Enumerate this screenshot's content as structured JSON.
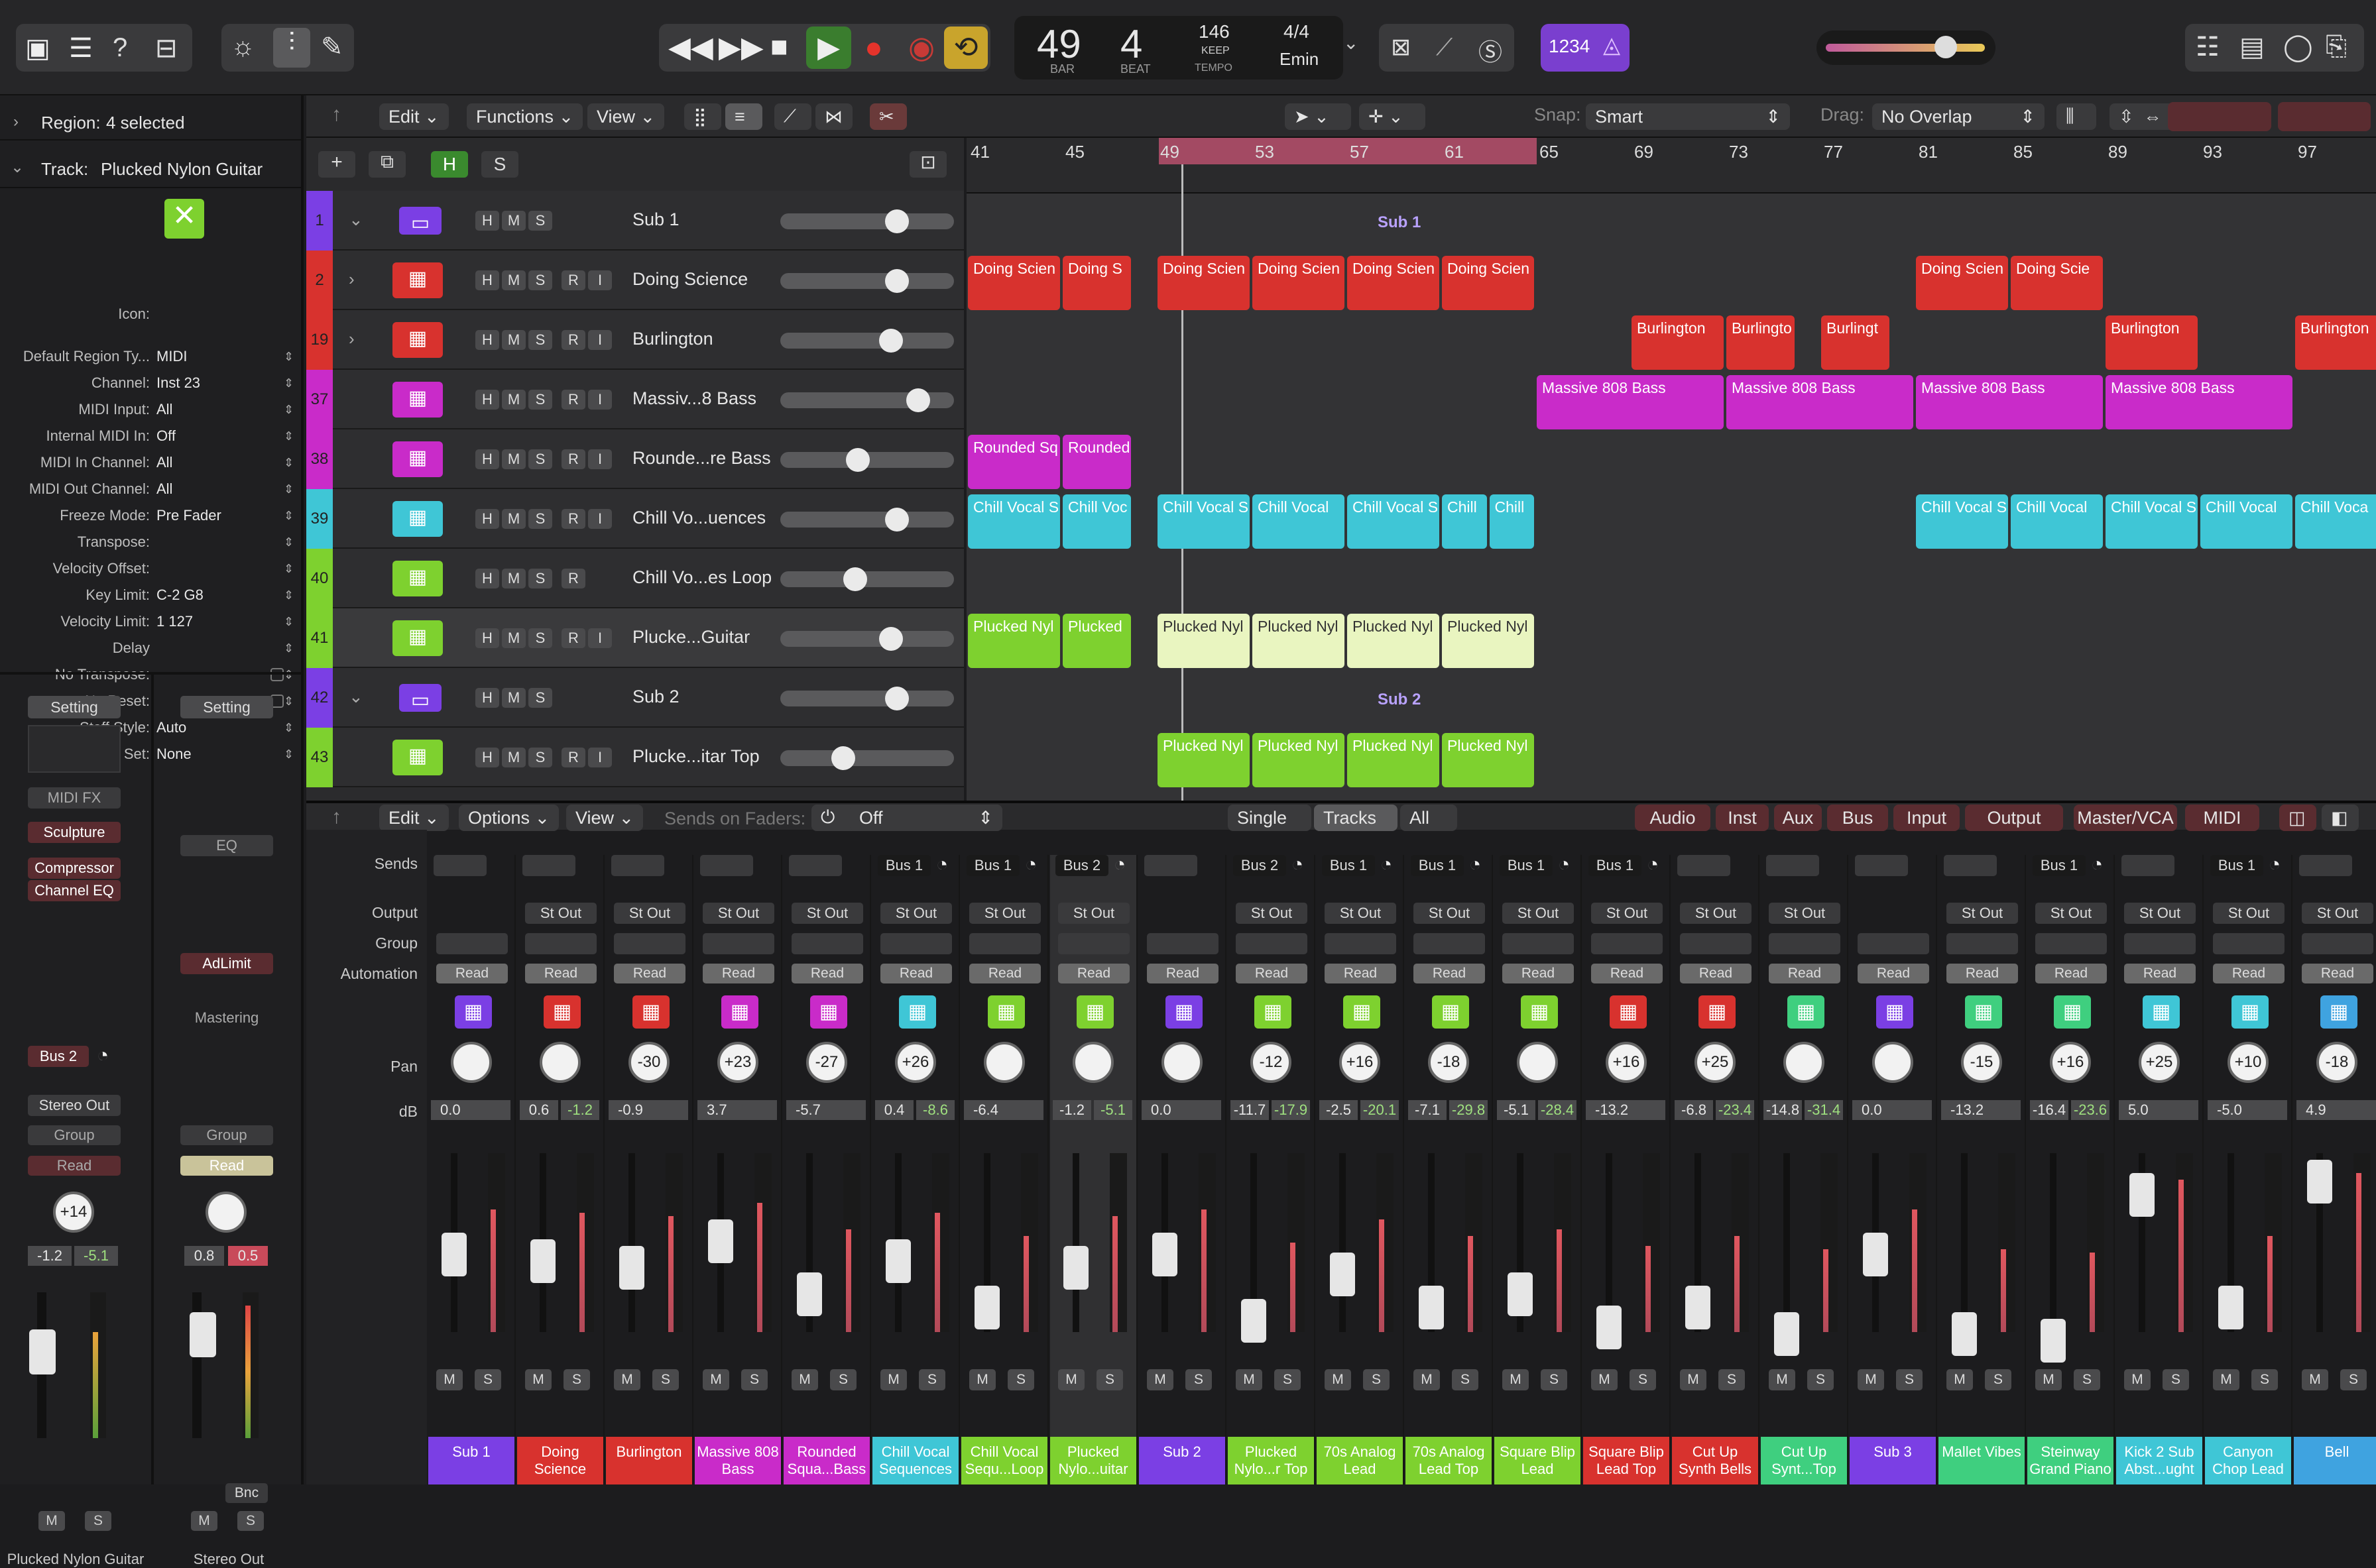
{
  "transport": {
    "bar": "49",
    "beat": "4",
    "bar_label": "BAR",
    "beat_label": "BEAT",
    "tempo": "146",
    "tempo_mode": "KEEP",
    "tempo_label": "TEMPO",
    "signature": "4/4",
    "key": "Emin",
    "cycle_counter": "1234"
  },
  "inspector": {
    "region_label": "Region:",
    "region_value": "4 selected",
    "track_label": "Track:",
    "track_value": "Plucked Nylon Guitar",
    "rows": [
      {
        "label": "Icon:",
        "value": ""
      },
      {
        "label": "Default Region Ty...",
        "value": "MIDI"
      },
      {
        "label": "Channel:",
        "value": "Inst 23"
      },
      {
        "label": "MIDI Input:",
        "value": "All"
      },
      {
        "label": "Internal MIDI In:",
        "value": "Off"
      },
      {
        "label": "MIDI In Channel:",
        "value": "All"
      },
      {
        "label": "MIDI Out Channel:",
        "value": "All"
      },
      {
        "label": "Freeze Mode:",
        "value": "Pre Fader"
      },
      {
        "label": "Transpose:",
        "value": ""
      },
      {
        "label": "Velocity Offset:",
        "value": ""
      },
      {
        "label": "Key Limit:",
        "value": "C-2  G8"
      },
      {
        "label": "Velocity Limit:",
        "value": "1  127"
      },
      {
        "label": "Delay",
        "value": ""
      },
      {
        "label": "No Transpose:",
        "value": ""
      },
      {
        "label": "No Reset:",
        "value": ""
      },
      {
        "label": "Staff Style:",
        "value": "Auto"
      },
      {
        "label": "Articulation Set:",
        "value": "None"
      }
    ]
  },
  "channel_left": {
    "setting": "Setting",
    "midi_fx": "MIDI FX",
    "plugins": [
      "Sculpture",
      "Compressor",
      "Channel EQ"
    ],
    "send": "Bus 2",
    "output": "Stereo Out",
    "group": "Group",
    "automation": "Read",
    "pan": "+14",
    "db1": "-1.2",
    "db2": "-5.1",
    "m": "M",
    "s": "S",
    "name": "Plucked Nylon Guitar"
  },
  "channel_right": {
    "setting": "Setting",
    "eq": "EQ",
    "plugins": [
      "AdLimit"
    ],
    "mastering": "Mastering",
    "group": "Group",
    "automation": "Read",
    "db1": "0.8",
    "db2": "0.5",
    "bnc": "Bnc",
    "m": "M",
    "s": "S",
    "name": "Stereo Out"
  },
  "tracks_menu": {
    "edit": "Edit",
    "functions": "Functions",
    "view": "View",
    "snap_label": "Snap:",
    "snap": "Smart",
    "drag_label": "Drag:",
    "drag": "No Overlap",
    "h": "H",
    "s": "S"
  },
  "ruler": [
    "41",
    "45",
    "49",
    "53",
    "57",
    "61",
    "65",
    "69",
    "73",
    "77",
    "81",
    "85",
    "89",
    "93",
    "97"
  ],
  "tracks": [
    {
      "num": "1",
      "name": "Sub 1",
      "color": "#7b3fe4",
      "flags": [
        "H",
        "M",
        "S"
      ]
    },
    {
      "num": "2",
      "name": "Doing Science",
      "color": "#d8322e",
      "flags": [
        "H",
        "M",
        "S",
        "R",
        "I"
      ]
    },
    {
      "num": "19",
      "name": "Burlington",
      "color": "#d8322e",
      "flags": [
        "H",
        "M",
        "S",
        "R",
        "I"
      ]
    },
    {
      "num": "37",
      "name": "Massiv...8 Bass",
      "color": "#c92bc9",
      "flags": [
        "H",
        "M",
        "S",
        "R",
        "I"
      ]
    },
    {
      "num": "38",
      "name": "Rounde...re Bass",
      "color": "#c92bc9",
      "flags": [
        "H",
        "M",
        "S",
        "R",
        "I"
      ]
    },
    {
      "num": "39",
      "name": "Chill Vo...uences",
      "color": "#3fc6d6",
      "flags": [
        "H",
        "M",
        "S",
        "R",
        "I"
      ]
    },
    {
      "num": "40",
      "name": "Chill Vo...es Loop",
      "color": "#7ed12f",
      "flags": [
        "H",
        "M",
        "S",
        "R"
      ]
    },
    {
      "num": "41",
      "name": "Plucke...Guitar",
      "color": "#7ed12f",
      "flags": [
        "H",
        "M",
        "S",
        "R",
        "I"
      ]
    },
    {
      "num": "42",
      "name": "Sub 2",
      "color": "#7b3fe4",
      "flags": [
        "H",
        "M",
        "S"
      ]
    },
    {
      "num": "43",
      "name": "Plucke...itar Top",
      "color": "#7ed12f",
      "flags": [
        "H",
        "M",
        "S",
        "R",
        "I"
      ]
    }
  ],
  "regions": {
    "sub1": "Sub 1",
    "sub2": "Sub 2",
    "doing": "Doing Scien",
    "doing_s": "Doing S",
    "doing_scie": "Doing Scie",
    "burl": "Burlington",
    "burl_short": "Burlingto",
    "burl_shorter": "Burlingt",
    "massive": "Massive 808 Bass",
    "rounded": "Rounded Sq",
    "rounded2": "Rounded",
    "chill": "Chill Vocal S",
    "chill2": "Chill Voc",
    "chill3": "Chill Vocal",
    "chill4": "Chill",
    "chill5": "Chill Voca",
    "pluck": "Plucked Nyl",
    "pluck2": "Plucked"
  },
  "mixer_menu": {
    "edit": "Edit",
    "options": "Options",
    "view": "View",
    "sends_label": "Sends on Faders:",
    "sends_value": "Off",
    "single": "Single",
    "tracks": "Tracks",
    "all": "All",
    "filters": [
      "Audio",
      "Inst",
      "Aux",
      "Bus",
      "Input",
      "Output",
      "Master/VCA",
      "MIDI"
    ],
    "row_labels": [
      "Sends",
      "Output",
      "Group",
      "Automation",
      "Pan",
      "dB"
    ]
  },
  "strips": [
    {
      "name": "Sub 1",
      "color": "#7b3fe4",
      "bus": "",
      "out": "",
      "pan": "",
      "db": "0.0",
      "db2": ""
    },
    {
      "name": "Doing Science",
      "color": "#d8322e",
      "bus": "",
      "out": "St Out",
      "pan": "",
      "db": "0.6",
      "db2": "-1.2"
    },
    {
      "name": "Burlington",
      "color": "#d8322e",
      "bus": "",
      "out": "St Out",
      "pan": "-30",
      "db": "-0.9",
      "db2": ""
    },
    {
      "name": "Massive 808 Bass",
      "color": "#c92bc9",
      "bus": "",
      "out": "St Out",
      "pan": "+23",
      "db": "3.7",
      "db2": ""
    },
    {
      "name": "Rounded Squa...Bass",
      "color": "#c92bc9",
      "bus": "",
      "out": "St Out",
      "pan": "-27",
      "db": "-5.7",
      "db2": ""
    },
    {
      "name": "Chill Vocal Sequences",
      "color": "#3fc6d6",
      "bus": "Bus 1",
      "out": "St Out",
      "pan": "+26",
      "db": "0.4",
      "db2": "-8.6"
    },
    {
      "name": "Chill Vocal Sequ...Loop",
      "color": "#7ed12f",
      "bus": "Bus 1",
      "out": "St Out",
      "pan": "",
      "db": "-6.4",
      "db2": ""
    },
    {
      "name": "Plucked Nylo...uitar",
      "color": "#7ed12f",
      "bus": "Bus 2",
      "out": "St Out",
      "pan": "",
      "db": "-1.2",
      "db2": "-5.1"
    },
    {
      "name": "Sub 2",
      "color": "#7b3fe4",
      "bus": "",
      "out": "",
      "pan": "",
      "db": "0.0",
      "db2": ""
    },
    {
      "name": "Plucked Nylo...r Top",
      "color": "#7ed12f",
      "bus": "Bus 2",
      "out": "St Out",
      "pan": "-12",
      "db": "-11.7",
      "db2": "-17.9"
    },
    {
      "name": "70s Analog Lead",
      "color": "#7ed12f",
      "bus": "Bus 1",
      "out": "St Out",
      "pan": "+16",
      "db": "-2.5",
      "db2": "-20.1"
    },
    {
      "name": "70s Analog Lead Top",
      "color": "#7ed12f",
      "bus": "Bus 1",
      "out": "St Out",
      "pan": "-18",
      "db": "-7.1",
      "db2": "-29.8"
    },
    {
      "name": "Square Blip Lead",
      "color": "#7ed12f",
      "bus": "Bus 1",
      "out": "St Out",
      "pan": "",
      "db": "-5.1",
      "db2": "-28.4"
    },
    {
      "name": "Square Blip Lead Top",
      "color": "#d8322e",
      "bus": "Bus 1",
      "out": "St Out",
      "pan": "+16",
      "db": "-13.2",
      "db2": ""
    },
    {
      "name": "Cut Up Synth Bells",
      "color": "#d8322e",
      "bus": "",
      "out": "St Out",
      "pan": "+25",
      "db": "-6.8",
      "db2": "-23.4"
    },
    {
      "name": "Cut Up Synt...Top",
      "color": "#3fcf7f",
      "bus": "",
      "out": "St Out",
      "pan": "",
      "db": "-14.8",
      "db2": "-31.4"
    },
    {
      "name": "Sub 3",
      "color": "#7b3fe4",
      "bus": "",
      "out": "",
      "pan": "",
      "db": "0.0",
      "db2": ""
    },
    {
      "name": "Mallet Vibes",
      "color": "#3fcf7f",
      "bus": "",
      "out": "St Out",
      "pan": "-15",
      "db": "-13.2",
      "db2": ""
    },
    {
      "name": "Steinway Grand Piano",
      "color": "#3fcf7f",
      "bus": "Bus 1",
      "out": "St Out",
      "pan": "+16",
      "db": "-16.4",
      "db2": "-23.6"
    },
    {
      "name": "Kick 2 Sub Abst...ught",
      "color": "#3fc6d6",
      "bus": "",
      "out": "St Out",
      "pan": "+25",
      "db": "5.0",
      "db2": ""
    },
    {
      "name": "Canyon Chop Lead",
      "color": "#3fc6d6",
      "bus": "Bus 1",
      "out": "St Out",
      "pan": "+10",
      "db": "-5.0",
      "db2": ""
    },
    {
      "name": "Bell",
      "color": "#3fa3e0",
      "bus": "",
      "out": "St Out",
      "pan": "-18",
      "db": "4.9",
      "db2": ""
    }
  ],
  "strip_read": "Read",
  "strip_m": "M",
  "strip_s": "S"
}
